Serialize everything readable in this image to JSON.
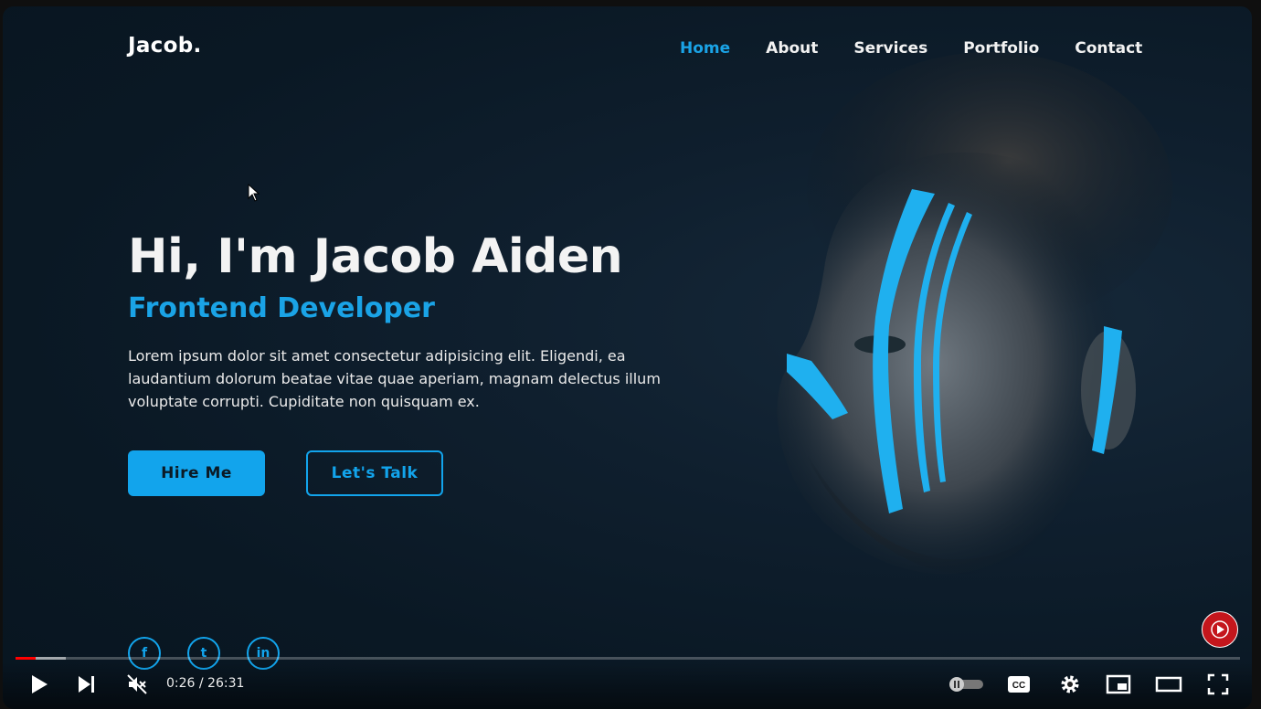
{
  "nav": {
    "logo": "Jacob.",
    "items": [
      {
        "label": "Home",
        "active": true
      },
      {
        "label": "About",
        "active": false
      },
      {
        "label": "Services",
        "active": false
      },
      {
        "label": "Portfolio",
        "active": false
      },
      {
        "label": "Contact",
        "active": false
      }
    ]
  },
  "hero": {
    "title": "Hi, I'm Jacob Aiden",
    "subtitle": "Frontend Developer",
    "description": "Lorem ipsum dolor sit amet consectetur adipisicing elit. Eligendi, ea laudantium dolorum beatae vitae quae aperiam, magnam delectus illum voluptate corrupti. Cupiditate non quisquam ex.",
    "primary_button": "Hire Me",
    "secondary_button": "Let's Talk"
  },
  "social": [
    {
      "icon": "facebook-icon",
      "glyph": "f"
    },
    {
      "icon": "twitter-icon",
      "glyph": "t"
    },
    {
      "icon": "linkedin-icon",
      "glyph": "in"
    }
  ],
  "player": {
    "time": "0:26 / 26:31",
    "progress_played": 0.0163,
    "progress_loaded": 0.041,
    "muted": true,
    "autoplay_on": false
  },
  "colors": {
    "accent": "#12a4ec",
    "background": "#0a1824",
    "progress_red": "#ff0000"
  }
}
